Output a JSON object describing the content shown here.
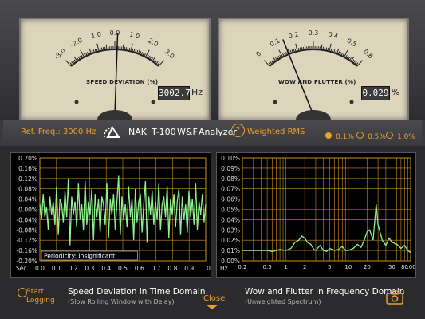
{
  "meters": {
    "speed": {
      "title": "SPEED DEVIATION (%)",
      "readout": "3002.7",
      "unit": "Hz",
      "scale": [
        "-3.0",
        "-2.0",
        "-1.0",
        "0.0",
        "1.0",
        "2.0",
        "3.0"
      ]
    },
    "wow": {
      "title": "WOW AND FLUTTER (%)",
      "readout": "0.029",
      "unit": "%",
      "scale": [
        "0",
        "0.1",
        "0.2",
        "0.3",
        "0.4",
        "0.5",
        "0.6"
      ]
    }
  },
  "controls": {
    "ref_freq": "Ref. Freq.: 3000 Hz",
    "standard": "NAK",
    "model": "T-100",
    "analyzer": "W&F",
    "analyzer_label": "Analyzer",
    "help": "?",
    "weighted": "Weighted RMS",
    "ranges": [
      {
        "label": "0.1%",
        "selected": true
      },
      {
        "label": "0.5%",
        "selected": false
      },
      {
        "label": "1.0%",
        "selected": false
      }
    ]
  },
  "colors": {
    "accent": "#e8a032",
    "trace": "#8ef08e",
    "grid": "#c8901e"
  },
  "chart_data": [
    {
      "type": "line",
      "title": "Speed Deviation in Time Domain",
      "subtitle": "(Slow Rolling Window with Delay)",
      "xlabel": "Sec.",
      "x_ticks": [
        "0.0",
        "0.1",
        "0.2",
        "0.3",
        "0.4",
        "0.5",
        "0.6",
        "0.7",
        "0.8",
        "0.9",
        "1.0"
      ],
      "y_ticks": [
        "0.20%",
        "0.16%",
        "0.12%",
        "0.08%",
        "0.04%",
        "0.00%",
        "-0.04%",
        "-0.08%",
        "-0.12%",
        "-0.16%",
        "-0.20%"
      ],
      "ylim": [
        -0.2,
        0.2
      ],
      "xlim": [
        0,
        1
      ],
      "annotation": "Periodicity: Insignificant",
      "values": [
        0.02,
        -0.04,
        0.06,
        -0.03,
        0.01,
        -0.08,
        0.05,
        -0.02,
        0.03,
        -0.06,
        0.09,
        -0.1,
        0.04,
        0.02,
        -0.05,
        0.07,
        -0.03,
        0.12,
        -0.14,
        0.05,
        -0.02,
        0.03,
        -0.07,
        0.1,
        -0.04,
        0.02,
        -0.08,
        0.11,
        -0.06,
        0.03,
        -0.02,
        0.08,
        -0.12,
        0.06,
        -0.03,
        0.04,
        -0.09,
        0.05,
        0.02,
        -0.06,
        0.1,
        -0.11,
        0.04,
        -0.02,
        0.06,
        -0.08,
        0.03,
        0.13,
        -0.1,
        0.05,
        -0.04,
        0.02,
        -0.07,
        0.09,
        -0.03,
        0.04,
        -0.12,
        0.08,
        -0.05,
        0.03,
        0.06,
        -0.09,
        0.02,
        0.11,
        -0.13,
        0.05,
        -0.02,
        0.07,
        -0.06,
        0.03,
        -0.04,
        0.1,
        -0.08,
        0.02,
        0.05,
        -0.03,
        0.09,
        -0.11,
        0.04,
        -0.02,
        0.06,
        -0.07,
        0.03,
        0.08,
        -0.1,
        0.05,
        -0.04,
        0.02,
        -0.09,
        0.07,
        -0.03,
        0.04,
        -0.06,
        0.1,
        -0.08,
        0.03,
        -0.02,
        0.06,
        -0.05,
        0.02
      ]
    },
    {
      "type": "line",
      "title": "Wow and Flutter in Frequency Domain",
      "subtitle": "(Unweighted Spectrum)",
      "xlabel": "Hz",
      "x_ticks": [
        "0.2",
        "0.5",
        "1",
        "2",
        "5",
        "10",
        "20",
        "50",
        "80",
        "100"
      ],
      "x_tick_values": [
        0.2,
        0.5,
        1,
        2,
        5,
        10,
        20,
        50,
        80,
        100
      ],
      "y_ticks": [
        "0.10%",
        "0.09%",
        "0.08%",
        "0.07%",
        "0.06%",
        "0.05%",
        "0.04%",
        "0.03%",
        "0.02%",
        "0.01%",
        "0.00%"
      ],
      "ylim": [
        0,
        0.1
      ],
      "xlim": [
        0.2,
        100
      ],
      "x_scale": "log",
      "x": [
        0.2,
        0.3,
        0.4,
        0.5,
        0.6,
        0.7,
        0.8,
        1,
        1.2,
        1.4,
        1.6,
        1.8,
        2,
        2.2,
        2.5,
        2.8,
        3,
        3.5,
        4,
        4.5,
        5,
        6,
        7,
        8,
        9,
        10,
        12,
        14,
        16,
        18,
        20,
        22,
        25,
        28,
        30,
        35,
        40,
        45,
        50,
        60,
        70,
        80,
        90,
        100
      ],
      "values": [
        0.01,
        0.01,
        0.01,
        0.01,
        0.009,
        0.01,
        0.011,
        0.01,
        0.012,
        0.018,
        0.02,
        0.024,
        0.022,
        0.018,
        0.016,
        0.011,
        0.01,
        0.015,
        0.01,
        0.009,
        0.012,
        0.01,
        0.011,
        0.014,
        0.01,
        0.01,
        0.012,
        0.016,
        0.013,
        0.02,
        0.028,
        0.03,
        0.02,
        0.055,
        0.035,
        0.02,
        0.015,
        0.022,
        0.018,
        0.016,
        0.012,
        0.015,
        0.01,
        0.008
      ]
    }
  ],
  "footer": {
    "start_logging_1": "Start",
    "start_logging_2": "Logging",
    "close": "Close"
  }
}
